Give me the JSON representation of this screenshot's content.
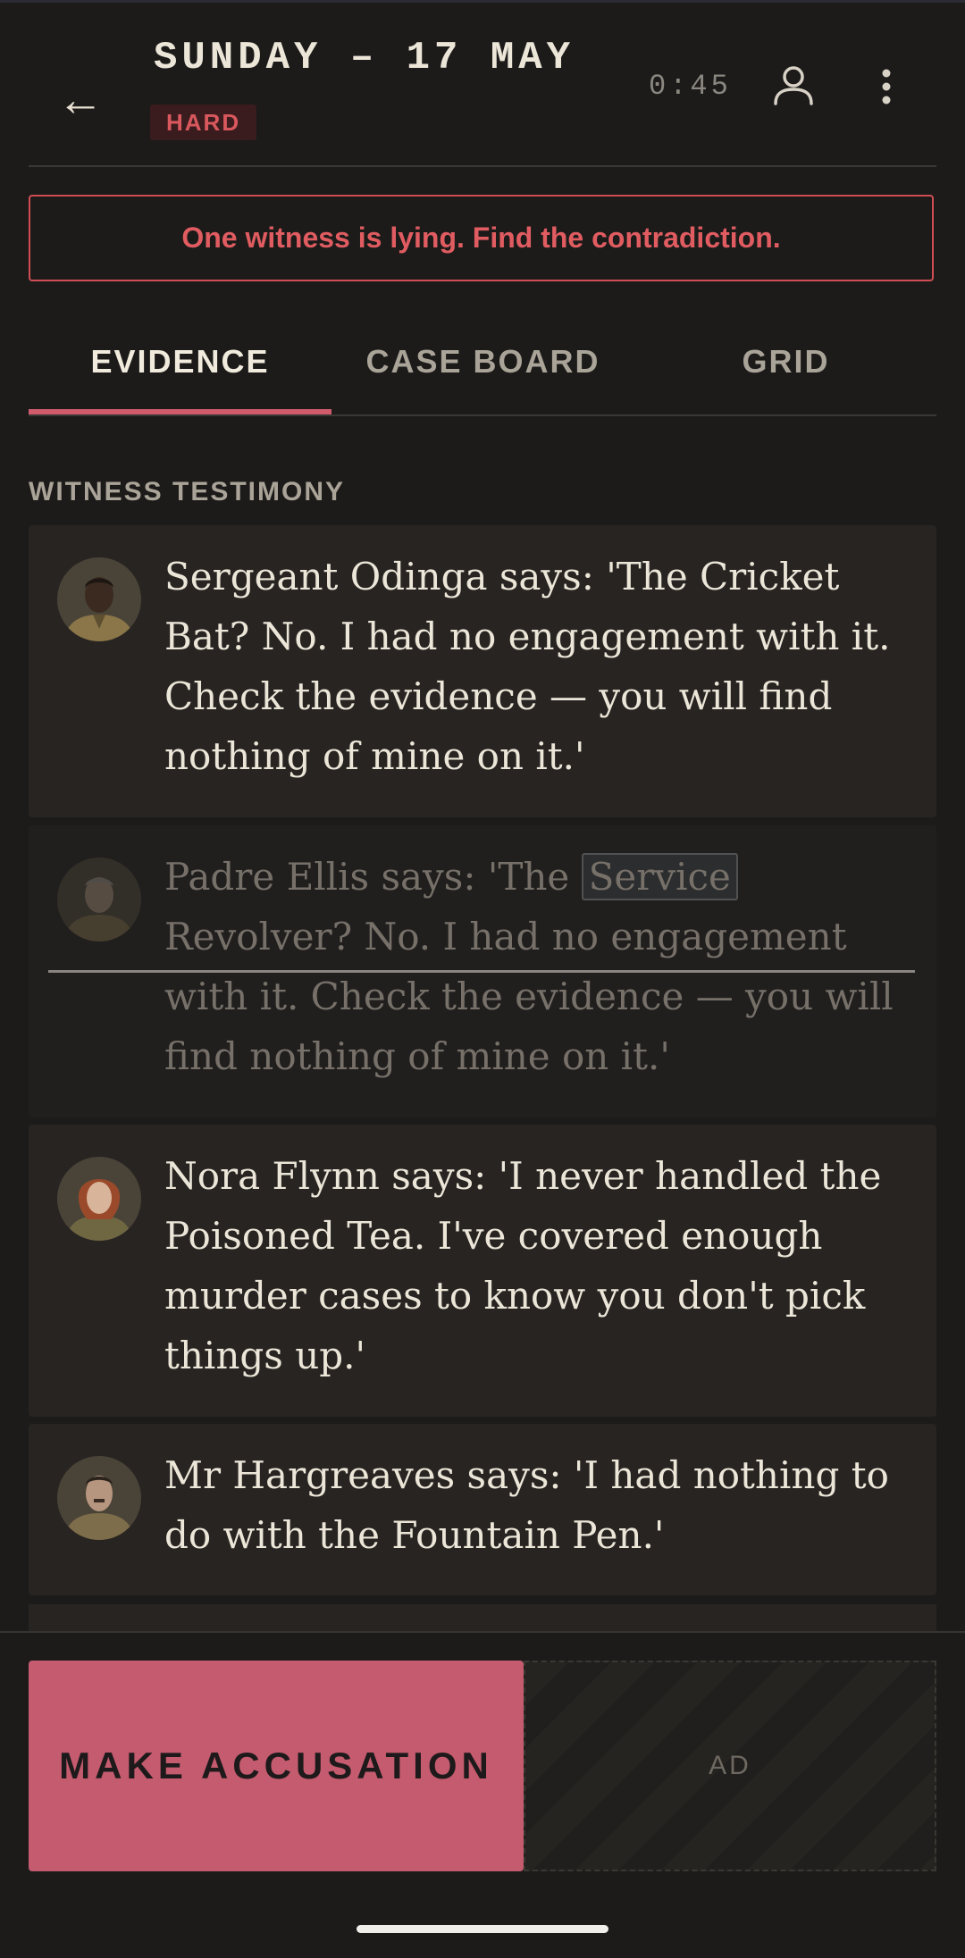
{
  "header": {
    "back_icon": "arrow-left-icon",
    "title": "SUNDAY – 17 MAY",
    "difficulty": "HARD",
    "timer": "0:45",
    "profile_icon": "user-icon",
    "menu_icon": "more-vertical-icon"
  },
  "banner": {
    "text": "One witness is lying. Find the contradiction."
  },
  "tabs": [
    {
      "label": "EVIDENCE",
      "active": true
    },
    {
      "label": "CASE BOARD",
      "active": false
    },
    {
      "label": "GRID",
      "active": false
    }
  ],
  "section_label": "WITNESS TESTIMONY",
  "testimonies": [
    {
      "text": "Sergeant Odinga says: 'The Cricket Bat? No. I had no engagement with it. Check the evidence — you will find nothing of mine on it.'",
      "dimmed": false
    },
    {
      "before": "Padre Ellis says: 'The ",
      "highlight": "Service",
      "after": " Revolver? No. I had no engagement with it. Check the evidence — you will find nothing of mine on it.'",
      "dimmed": true,
      "struck": true
    },
    {
      "text": "Nora Flynn says: 'I never handled the Poisoned Tea. I've covered enough murder cases to know you don't pick things up.'",
      "dimmed": false
    },
    {
      "text": "Mr Hargreaves says: 'I had nothing to do with the Fountain Pen.'",
      "dimmed": false
    }
  ],
  "actions": {
    "accuse_label": "MAKE ACCUSATION",
    "ad_label": "AD"
  },
  "colors": {
    "background": "#1c1b1a",
    "accent_red": "#cf4e55",
    "accuse_button": "#c45b6e",
    "card": "#272422"
  }
}
